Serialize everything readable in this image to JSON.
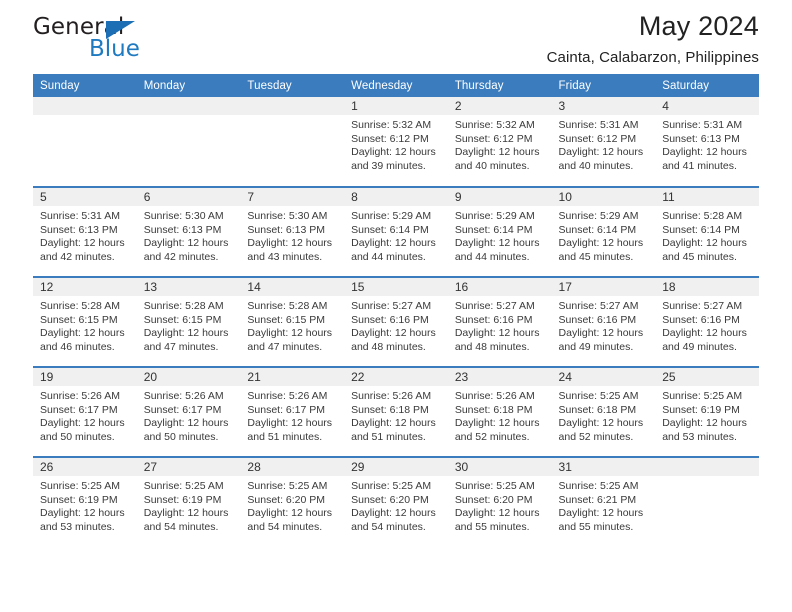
{
  "brand": {
    "name_top": "General",
    "name_bottom": "Blue"
  },
  "header": {
    "title": "May 2024",
    "subtitle": "Cainta, Calabarzon, Philippines"
  },
  "calendar": {
    "weekday_headers": [
      "Sunday",
      "Monday",
      "Tuesday",
      "Wednesday",
      "Thursday",
      "Friday",
      "Saturday"
    ],
    "accent_color": "#3b7cbe",
    "daynum_band_color": "#f0f0f0",
    "weeks": [
      [
        {
          "day": "",
          "lines": []
        },
        {
          "day": "",
          "lines": []
        },
        {
          "day": "",
          "lines": []
        },
        {
          "day": "1",
          "lines": [
            "Sunrise: 5:32 AM",
            "Sunset: 6:12 PM",
            "Daylight: 12 hours",
            "and 39 minutes."
          ]
        },
        {
          "day": "2",
          "lines": [
            "Sunrise: 5:32 AM",
            "Sunset: 6:12 PM",
            "Daylight: 12 hours",
            "and 40 minutes."
          ]
        },
        {
          "day": "3",
          "lines": [
            "Sunrise: 5:31 AM",
            "Sunset: 6:12 PM",
            "Daylight: 12 hours",
            "and 40 minutes."
          ]
        },
        {
          "day": "4",
          "lines": [
            "Sunrise: 5:31 AM",
            "Sunset: 6:13 PM",
            "Daylight: 12 hours",
            "and 41 minutes."
          ]
        }
      ],
      [
        {
          "day": "5",
          "lines": [
            "Sunrise: 5:31 AM",
            "Sunset: 6:13 PM",
            "Daylight: 12 hours",
            "and 42 minutes."
          ]
        },
        {
          "day": "6",
          "lines": [
            "Sunrise: 5:30 AM",
            "Sunset: 6:13 PM",
            "Daylight: 12 hours",
            "and 42 minutes."
          ]
        },
        {
          "day": "7",
          "lines": [
            "Sunrise: 5:30 AM",
            "Sunset: 6:13 PM",
            "Daylight: 12 hours",
            "and 43 minutes."
          ]
        },
        {
          "day": "8",
          "lines": [
            "Sunrise: 5:29 AM",
            "Sunset: 6:14 PM",
            "Daylight: 12 hours",
            "and 44 minutes."
          ]
        },
        {
          "day": "9",
          "lines": [
            "Sunrise: 5:29 AM",
            "Sunset: 6:14 PM",
            "Daylight: 12 hours",
            "and 44 minutes."
          ]
        },
        {
          "day": "10",
          "lines": [
            "Sunrise: 5:29 AM",
            "Sunset: 6:14 PM",
            "Daylight: 12 hours",
            "and 45 minutes."
          ]
        },
        {
          "day": "11",
          "lines": [
            "Sunrise: 5:28 AM",
            "Sunset: 6:14 PM",
            "Daylight: 12 hours",
            "and 45 minutes."
          ]
        }
      ],
      [
        {
          "day": "12",
          "lines": [
            "Sunrise: 5:28 AM",
            "Sunset: 6:15 PM",
            "Daylight: 12 hours",
            "and 46 minutes."
          ]
        },
        {
          "day": "13",
          "lines": [
            "Sunrise: 5:28 AM",
            "Sunset: 6:15 PM",
            "Daylight: 12 hours",
            "and 47 minutes."
          ]
        },
        {
          "day": "14",
          "lines": [
            "Sunrise: 5:28 AM",
            "Sunset: 6:15 PM",
            "Daylight: 12 hours",
            "and 47 minutes."
          ]
        },
        {
          "day": "15",
          "lines": [
            "Sunrise: 5:27 AM",
            "Sunset: 6:16 PM",
            "Daylight: 12 hours",
            "and 48 minutes."
          ]
        },
        {
          "day": "16",
          "lines": [
            "Sunrise: 5:27 AM",
            "Sunset: 6:16 PM",
            "Daylight: 12 hours",
            "and 48 minutes."
          ]
        },
        {
          "day": "17",
          "lines": [
            "Sunrise: 5:27 AM",
            "Sunset: 6:16 PM",
            "Daylight: 12 hours",
            "and 49 minutes."
          ]
        },
        {
          "day": "18",
          "lines": [
            "Sunrise: 5:27 AM",
            "Sunset: 6:16 PM",
            "Daylight: 12 hours",
            "and 49 minutes."
          ]
        }
      ],
      [
        {
          "day": "19",
          "lines": [
            "Sunrise: 5:26 AM",
            "Sunset: 6:17 PM",
            "Daylight: 12 hours",
            "and 50 minutes."
          ]
        },
        {
          "day": "20",
          "lines": [
            "Sunrise: 5:26 AM",
            "Sunset: 6:17 PM",
            "Daylight: 12 hours",
            "and 50 minutes."
          ]
        },
        {
          "day": "21",
          "lines": [
            "Sunrise: 5:26 AM",
            "Sunset: 6:17 PM",
            "Daylight: 12 hours",
            "and 51 minutes."
          ]
        },
        {
          "day": "22",
          "lines": [
            "Sunrise: 5:26 AM",
            "Sunset: 6:18 PM",
            "Daylight: 12 hours",
            "and 51 minutes."
          ]
        },
        {
          "day": "23",
          "lines": [
            "Sunrise: 5:26 AM",
            "Sunset: 6:18 PM",
            "Daylight: 12 hours",
            "and 52 minutes."
          ]
        },
        {
          "day": "24",
          "lines": [
            "Sunrise: 5:25 AM",
            "Sunset: 6:18 PM",
            "Daylight: 12 hours",
            "and 52 minutes."
          ]
        },
        {
          "day": "25",
          "lines": [
            "Sunrise: 5:25 AM",
            "Sunset: 6:19 PM",
            "Daylight: 12 hours",
            "and 53 minutes."
          ]
        }
      ],
      [
        {
          "day": "26",
          "lines": [
            "Sunrise: 5:25 AM",
            "Sunset: 6:19 PM",
            "Daylight: 12 hours",
            "and 53 minutes."
          ]
        },
        {
          "day": "27",
          "lines": [
            "Sunrise: 5:25 AM",
            "Sunset: 6:19 PM",
            "Daylight: 12 hours",
            "and 54 minutes."
          ]
        },
        {
          "day": "28",
          "lines": [
            "Sunrise: 5:25 AM",
            "Sunset: 6:20 PM",
            "Daylight: 12 hours",
            "and 54 minutes."
          ]
        },
        {
          "day": "29",
          "lines": [
            "Sunrise: 5:25 AM",
            "Sunset: 6:20 PM",
            "Daylight: 12 hours",
            "and 54 minutes."
          ]
        },
        {
          "day": "30",
          "lines": [
            "Sunrise: 5:25 AM",
            "Sunset: 6:20 PM",
            "Daylight: 12 hours",
            "and 55 minutes."
          ]
        },
        {
          "day": "31",
          "lines": [
            "Sunrise: 5:25 AM",
            "Sunset: 6:21 PM",
            "Daylight: 12 hours",
            "and 55 minutes."
          ]
        },
        {
          "day": "",
          "lines": []
        }
      ]
    ]
  }
}
